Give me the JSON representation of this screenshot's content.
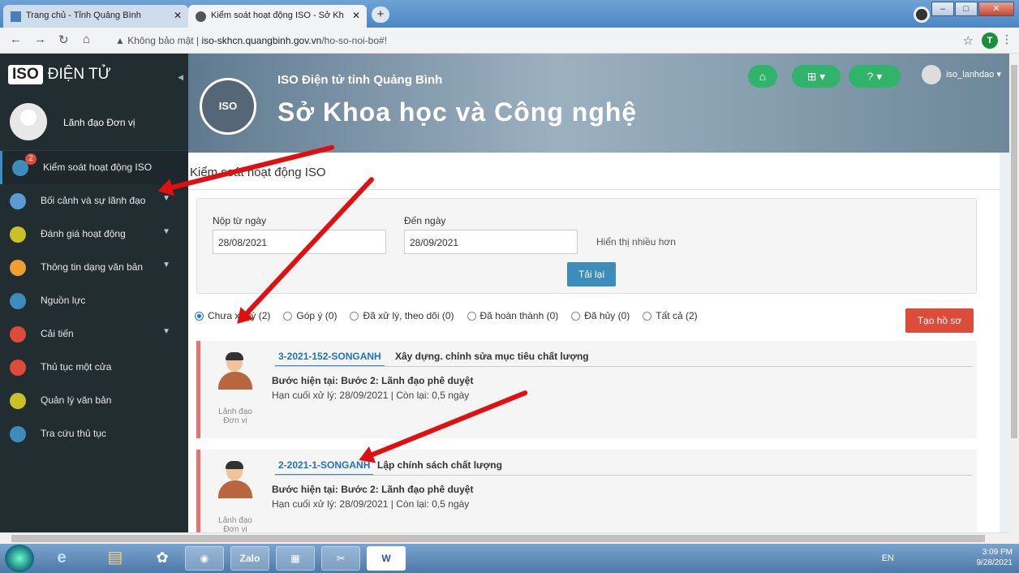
{
  "browser": {
    "tab1_title": "Trang chủ - Tỉnh Quảng Bình",
    "tab2_title": "Kiểm soát hoạt động ISO - Sở Kh",
    "security": "Không bảo mật",
    "url_domain": "iso-skhcn.quangbinh.gov.vn",
    "url_path": "/ho-so-noi-bo#!",
    "profile_letter": "T"
  },
  "sidebar": {
    "logo_iso": "ISO",
    "logo_text": "ĐIỆN TỬ",
    "user_name": "Lãnh đạo Đơn vị",
    "items": [
      {
        "label": "Kiểm soát hoạt động ISO",
        "badge": "2",
        "color": "#3c8dbc"
      },
      {
        "label": "Bối cảnh và sự lãnh đạo",
        "color": "#5b9bd5"
      },
      {
        "label": "Đánh giá hoạt động",
        "color": "#c9c227"
      },
      {
        "label": "Thông tin dạng văn bản",
        "color": "#f0a030"
      },
      {
        "label": "Nguồn lực",
        "color": "#3c8dbc"
      },
      {
        "label": "Cải tiến",
        "color": "#dd4b39"
      },
      {
        "label": "Thủ tục một cửa",
        "color": "#dd4b39"
      },
      {
        "label": "Quản lý văn bản",
        "color": "#c9c227"
      },
      {
        "label": "Tra cứu thủ tục",
        "color": "#3c8dbc"
      }
    ]
  },
  "header": {
    "subtitle": "ISO Điện tử tỉnh Quảng Bình",
    "title": "Sở Khoa học và Công nghệ",
    "seal": "ISO",
    "username": "iso_lanhdao"
  },
  "main": {
    "page_title": "Kiểm soát hoạt động ISO",
    "from_label": "Nộp từ ngày",
    "from_value": "28/08/2021",
    "to_label": "Đến ngày",
    "to_value": "28/09/2021",
    "more_label": "Hiển thị nhiều hơn",
    "reload_label": "Tải lại",
    "create_label": "Tạo hồ sơ",
    "filters": [
      {
        "label": "Chưa xử lý (2)",
        "checked": true
      },
      {
        "label": "Góp ý (0)",
        "checked": false
      },
      {
        "label": "Đã xử lý, theo dõi (0)",
        "checked": false
      },
      {
        "label": "Đã hoàn thành (0)",
        "checked": false
      },
      {
        "label": "Đã hủy (0)",
        "checked": false
      },
      {
        "label": "Tất cả (2)",
        "checked": false
      }
    ],
    "records": [
      {
        "code": "3-2021-152-SONGANH",
        "title": "Xây dựng. chỉnh sửa mục tiêu chất lượng",
        "step": "Bước hiện tại: Bước 2: Lãnh đạo phê duyệt",
        "deadline": "Hạn cuối xử lý: 28/09/2021   | Còn lại: 0,5 ngày",
        "role": "Lãnh đạo Đơn vị"
      },
      {
        "code": "2-2021-1-SONGANH",
        "title": "Lập chính sách chất lượng",
        "step": "Bước hiện tại: Bước 2: Lãnh đạo phê duyệt",
        "deadline": "Hạn cuối xử lý: 28/09/2021   | Còn lại: 0,5 ngày",
        "role": "Lãnh đạo Đơn vị"
      }
    ]
  },
  "taskbar": {
    "zalo": "Zalo",
    "word": "W",
    "lang": "EN",
    "time": "3:09 PM",
    "date": "9/28/2021"
  }
}
